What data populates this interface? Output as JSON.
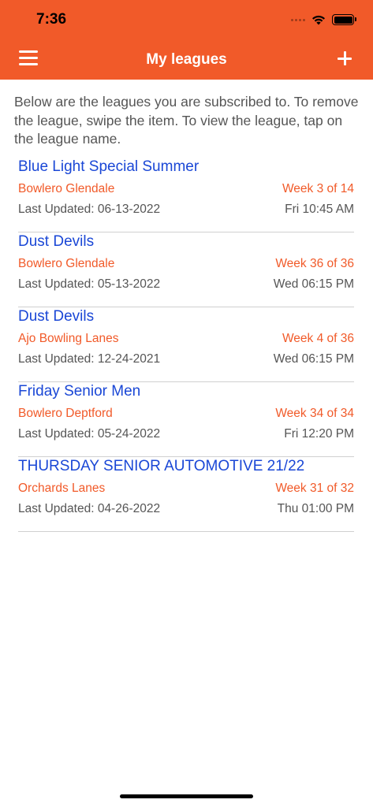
{
  "status_bar": {
    "time": "7:36"
  },
  "nav": {
    "title": "My leagues"
  },
  "intro_text": "Below are the leagues you are subscribed to. To remove the league, swipe the item. To view the league, tap on the league name.",
  "leagues": [
    {
      "name": "Blue Light Special Summer",
      "location": "Bowlero Glendale",
      "week": "Week 3 of 14",
      "updated": "Last Updated: 06-13-2022",
      "time": "Fri 10:45 AM"
    },
    {
      "name": "Dust Devils",
      "location": "Bowlero Glendale",
      "week": "Week 36 of 36",
      "updated": "Last Updated: 05-13-2022",
      "time": "Wed 06:15 PM"
    },
    {
      "name": "Dust Devils",
      "location": "Ajo Bowling Lanes",
      "week": "Week 4 of 36",
      "updated": "Last Updated: 12-24-2021",
      "time": "Wed 06:15 PM"
    },
    {
      "name": "Friday Senior Men",
      "location": "Bowlero Deptford",
      "week": "Week 34 of 34",
      "updated": "Last Updated: 05-24-2022",
      "time": "Fri 12:20 PM"
    },
    {
      "name": "THURSDAY SENIOR AUTOMOTIVE 21/22",
      "location": "Orchards Lanes",
      "week": "Week 31 of 32",
      "updated": "Last Updated: 04-26-2022",
      "time": "Thu 01:00 PM"
    }
  ],
  "colors": {
    "accent": "#f15a29",
    "link": "#1a47d6",
    "text": "#555555"
  },
  "icons": {
    "menu": "hamburger-icon",
    "add": "plus-icon",
    "wifi": "wifi-icon",
    "battery": "battery-icon"
  }
}
